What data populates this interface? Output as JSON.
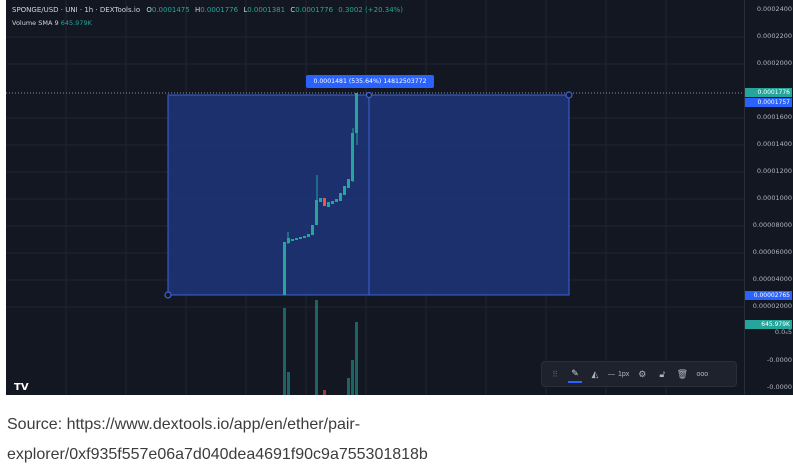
{
  "legend": {
    "pair": "SPONGE/USD · UNI · 1h · DEXTools.io",
    "o_label": "O",
    "o_value": "0.0001475",
    "h_label": "H",
    "h_value": "0.0001776",
    "l_label": "L",
    "l_value": "0.0001381",
    "c_label": "C",
    "c_value": "0.0001776",
    "change": "0.3002 (+20.34%)",
    "volume_label": "Volume SMA 9",
    "volume_value": "645.979K"
  },
  "tooltip": "0.0001481 (535.64%) 14812503772",
  "price_axis": {
    "ticks": [
      "0.0002400",
      "0.0002200",
      "0.0002000",
      "0.0001600",
      "0.0001400",
      "0.0001200",
      "0.0001000",
      "0.00008000",
      "0.00006000",
      "0.00004000",
      "0.00002000",
      "0.0₄5",
      "-0.0000",
      "-0.0000"
    ],
    "tag_current": "0.0001776",
    "tag_high": "0.0001757",
    "tag_low": "0.00002765",
    "tag_volume": "645.979K"
  },
  "toolbar": {
    "width_label": "1px"
  },
  "logo": "TV",
  "caption": {
    "line1": "Source: https://www.dextools.io/app/en/ether/pair-",
    "line2": "explorer/0xf935f557e06a7d040dea4691f90c9a755301818b"
  },
  "colors": {
    "up": "#26a69a",
    "down": "#ef5350",
    "accent": "#2962ff",
    "background": "#131722"
  }
}
